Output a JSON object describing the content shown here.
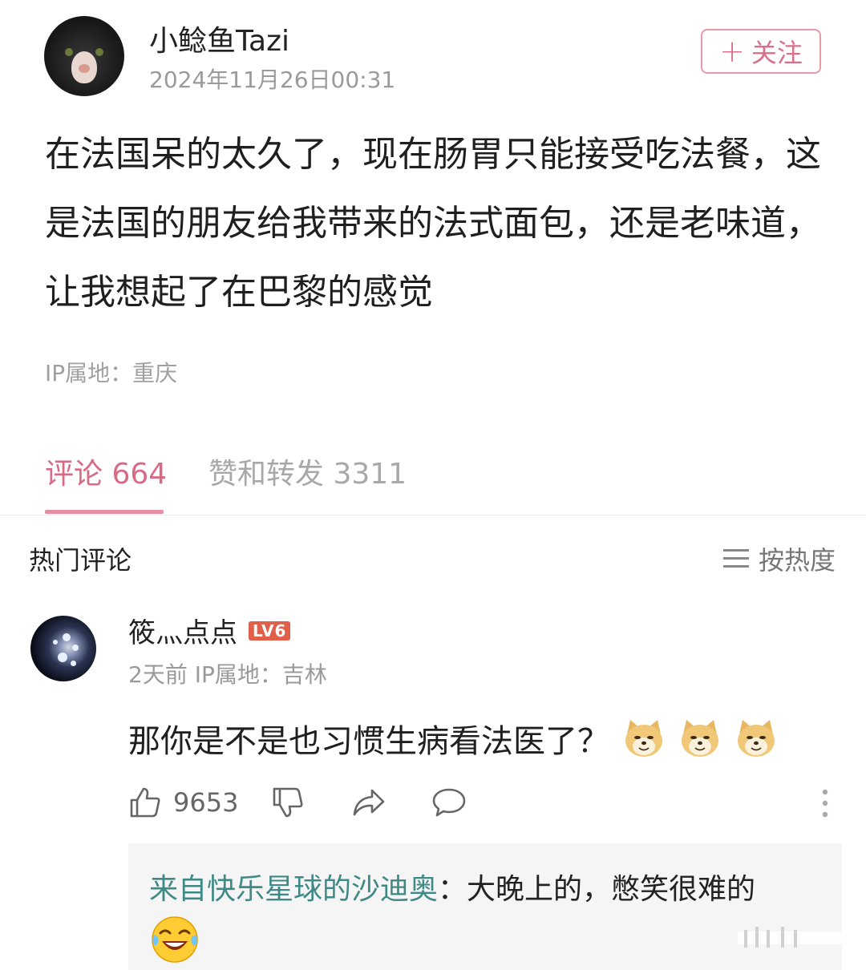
{
  "post": {
    "author_name": "小鲶鱼Tazi",
    "time": "2024年11月26日00:31",
    "follow_label": "关注",
    "body": "在法国呆的太久了，现在肠胃只能接受吃法餐，这是法国的朋友给我带来的法式面包，还是老味道，让我想起了在巴黎的感觉",
    "ip_location": "IP属地：重庆"
  },
  "tabs": [
    {
      "label": "评论 664",
      "active": true
    },
    {
      "label": "赞和转发 3311",
      "active": false
    }
  ],
  "hot_comments": {
    "title": "热门评论",
    "sort_label": "按热度"
  },
  "comment": {
    "author": "筱灬点点",
    "level": "LV6",
    "meta": "2天前 IP属地：吉林",
    "text": "那你是不是也习惯生病看法医了？",
    "emoji_count": 3,
    "likes": "9653",
    "reply": {
      "author": "来自快乐星球的沙迪奥",
      "text": "：大晚上的，憋笑很难的"
    }
  },
  "colors": {
    "accent": "#d76a85",
    "reply_author": "#3f8a86",
    "level_badge": "#e0604a"
  },
  "icons": [
    "plus-icon",
    "list-icon",
    "thumbs-up-icon",
    "thumbs-down-icon",
    "share-icon",
    "comment-icon",
    "more-icon",
    "doge-emoji",
    "laughing-crying-emoji"
  ]
}
